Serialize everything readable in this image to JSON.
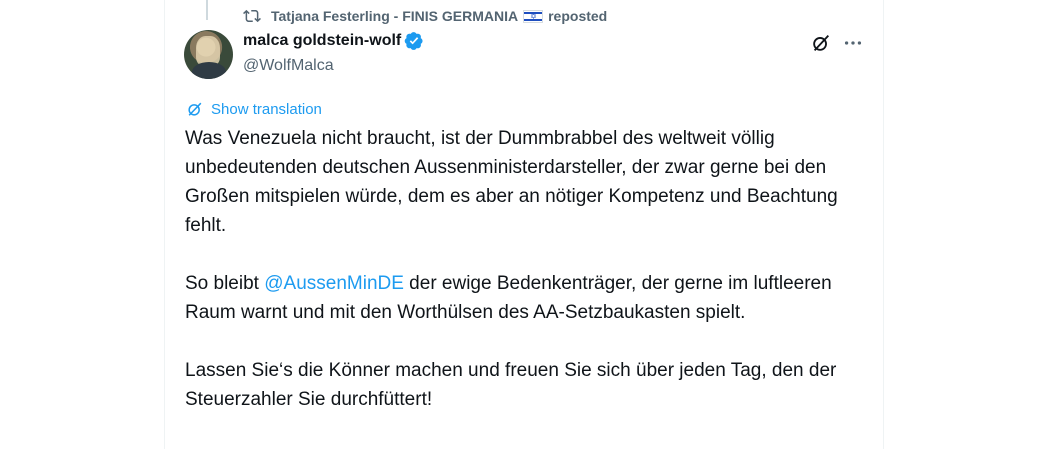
{
  "repost": {
    "user": "Tatjana Festerling - FINIS GERMANIA",
    "flag_icon": "israel-flag-icon",
    "label": "reposted"
  },
  "author": {
    "name": "malca goldstein-wolf",
    "handle": "@WolfMalca",
    "verified": true
  },
  "translation": {
    "label": "Show translation"
  },
  "tweet": {
    "p1": "Was Venezuela nicht braucht, ist der Dummbrabbel des weltweit völlig unbedeutenden deutschen Aussenministerdarsteller, der zwar gerne bei den Großen mitspielen würde, dem es aber an nötiger Kompetenz und Beachtung fehlt.",
    "p2_before": "So bleibt ",
    "p2_mention": "@AussenMinDE",
    "p2_after": " der ewige Bedenkenträger, der gerne im luftleeren Raum warnt und mit den Worthülsen des AA-Setzbaukasten spielt.",
    "p3": "Lassen Sie‘s die Könner machen und freuen Sie sich über jeden Tag, den der Steuerzahler Sie durchfüttert!"
  },
  "colors": {
    "accent": "#1d9bf0",
    "secondary_text": "#536471",
    "primary_text": "#0f1419"
  }
}
